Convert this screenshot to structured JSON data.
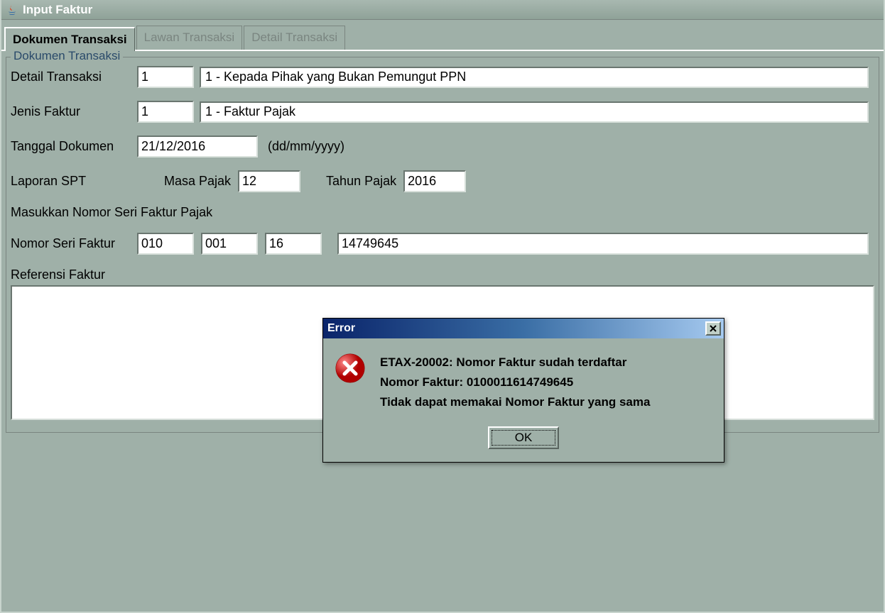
{
  "window": {
    "title": "Input Faktur"
  },
  "tabs": {
    "dokumen": "Dokumen Transaksi",
    "lawan": "Lawan Transaksi",
    "detail": "Detail Transaksi"
  },
  "fieldset": {
    "legend": "Dokumen Transaksi"
  },
  "labels": {
    "detail_transaksi": "Detail Transaksi",
    "jenis_faktur": "Jenis Faktur",
    "tanggal_dokumen": "Tanggal Dokumen",
    "date_format": "(dd/mm/yyyy)",
    "laporan_spt": "Laporan SPT",
    "masa_pajak": "Masa Pajak",
    "tahun_pajak": "Tahun Pajak",
    "masukkan_nsf": "Masukkan Nomor Seri Faktur Pajak",
    "nomor_seri": "Nomor Seri Faktur",
    "referensi": "Referensi Faktur"
  },
  "values": {
    "detail_code": "1",
    "detail_desc": "1 - Kepada Pihak yang Bukan Pemungut PPN",
    "jenis_code": "1",
    "jenis_desc": "1 - Faktur Pajak",
    "tanggal": "21/12/2016",
    "masa_pajak": "12",
    "tahun_pajak": "2016",
    "nsf_1": "010",
    "nsf_2": "001",
    "nsf_3": "16",
    "nsf_4": "14749645",
    "referensi": ""
  },
  "dialog": {
    "title": "Error",
    "line1": "ETAX-20002: Nomor Faktur sudah terdaftar",
    "line2": "Nomor Faktur: 0100011614749645",
    "line3": "Tidak dapat memakai Nomor Faktur yang sama",
    "ok": "OK"
  }
}
